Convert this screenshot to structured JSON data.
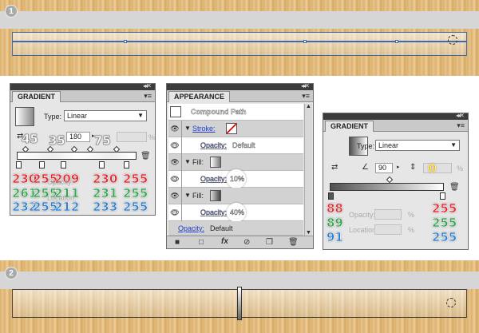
{
  "steps": [
    "1",
    "2"
  ],
  "gradient_left": {
    "tab": "GRADIENT",
    "type_label": "Type:",
    "type_value": "Linear",
    "angle_value": "180",
    "overlay_numbers": [
      "45",
      "35",
      "75"
    ],
    "rows": {
      "red": [
        "230",
        "255",
        "209",
        "230",
        "255"
      ],
      "green": [
        "261",
        "255",
        "211",
        "231",
        "255"
      ],
      "blue": [
        "232",
        "255",
        "212",
        "233",
        "255"
      ]
    },
    "opacity_label": "Opacity:",
    "location_label": "Location:"
  },
  "appearance": {
    "tab": "APPEARANCE",
    "header": "Compound Path",
    "stroke_label": "Stroke:",
    "opacity_label": "Opacity:",
    "default_value": "Default",
    "fill_label": "Fill:",
    "fill1_opacity": "10%",
    "fill2_opacity": "40%",
    "footer_icons": [
      "square-icon",
      "fill-square-icon",
      "fx-icon",
      "clear-icon",
      "duplicate-icon",
      "trash-icon"
    ]
  },
  "gradient_right": {
    "tab": "GRADIENT",
    "type_label": "Type:",
    "type_value": "Linear",
    "angle_value": "90",
    "overlay_number": "0",
    "left_values": [
      "88",
      "89",
      "91"
    ],
    "right_values": [
      "255",
      "255",
      "255"
    ],
    "opacity_label": "Opacity:",
    "location_label": "Location:",
    "percent": "%"
  }
}
